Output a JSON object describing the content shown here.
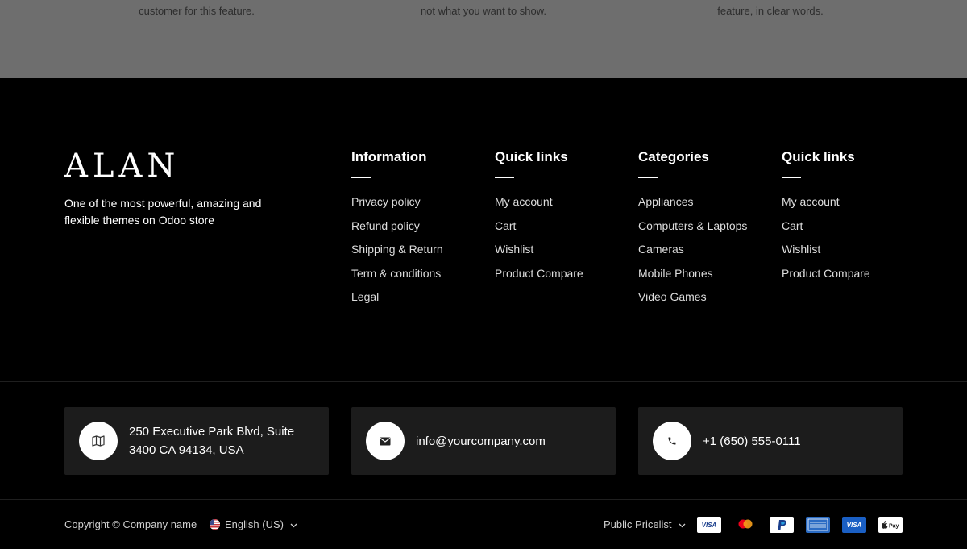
{
  "features": [
    "customer for this feature.",
    "not what you want to show.",
    "feature, in clear words."
  ],
  "brand": {
    "logo": "ALAN",
    "tagline": "One of the most powerful, amazing and flexible themes on Odoo store"
  },
  "columns": [
    {
      "title": "Information",
      "links": [
        "Privacy policy",
        "Refund policy",
        "Shipping & Return",
        "Term & conditions",
        "Legal"
      ]
    },
    {
      "title": "Quick links",
      "links": [
        "My account",
        "Cart",
        "Wishlist",
        "Product Compare"
      ]
    },
    {
      "title": "Categories",
      "links": [
        "Appliances",
        "Computers & Laptops",
        "Cameras",
        "Mobile Phones",
        "Video Games"
      ]
    },
    {
      "title": "Quick links",
      "links": [
        "My account",
        "Cart",
        "Wishlist",
        "Product Compare"
      ]
    }
  ],
  "contact": {
    "address": "250 Executive Park Blvd, Suite 3400 CA 94134, USA",
    "email": "info@yourcompany.com",
    "phone": "+1 (650) 555-0111"
  },
  "bottom": {
    "copyright": "Copyright © Company name",
    "language": "English (US)",
    "pricelist": "Public Pricelist"
  },
  "payment_icons": [
    "visa-icon",
    "mastercard-icon",
    "paypal-icon",
    "amex-icon",
    "visa-icon",
    "apple-pay-icon"
  ],
  "colors": {
    "footer_bg": "#000000",
    "card_bg": "#1c1c1c",
    "top_band_bg": "#6e6e6e"
  }
}
